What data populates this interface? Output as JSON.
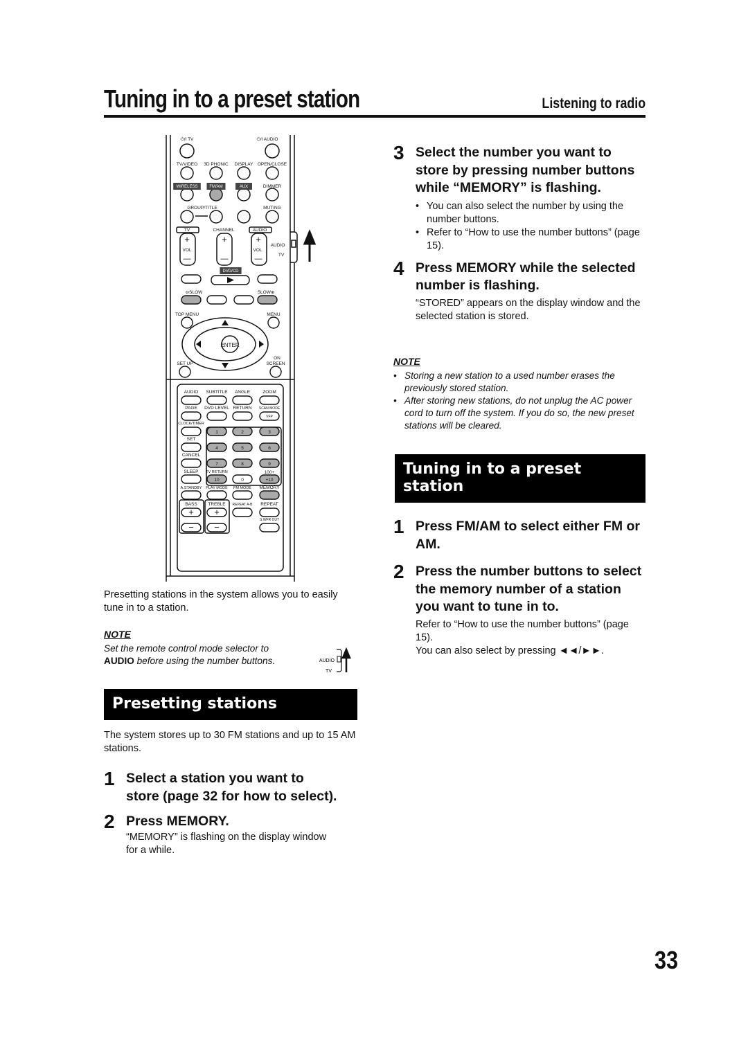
{
  "header": {
    "title": "Tuning in to a preset station",
    "section": "Listening to radio"
  },
  "left": {
    "intro": "Presetting stations in the system allows you to easily tune in to a station.",
    "note": {
      "heading": "NOTE",
      "line1": "Set the remote control mode selector to",
      "bold": "AUDIO",
      "line2": " before using the number buttons.",
      "switch_audio": "AUDIO",
      "switch_tv": "TV"
    },
    "banner": "Presetting stations",
    "desc": "The system stores up to 30 FM stations and up to 15 AM stations.",
    "steps": [
      {
        "num": "1",
        "head": "Select a station you want to store (page 32 for how to select)."
      },
      {
        "num": "2",
        "head": "Press MEMORY.",
        "text": "“MEMORY” is flashing on the display window for a while."
      }
    ]
  },
  "right": {
    "steps": [
      {
        "num": "3",
        "head": "Select the number you want to store by pressing number buttons while “MEMORY” is flashing.",
        "bullets": [
          "You can also select the number by using the number buttons.",
          "Refer to “How to use the number buttons” (page 15)."
        ]
      },
      {
        "num": "4",
        "head": "Press MEMORY while the selected number is flashing.",
        "text": "“STORED” appears on the display window and the selected station is stored."
      }
    ],
    "note": {
      "heading": "NOTE",
      "items": [
        "Storing a new station to a used number erases the previously stored station.",
        "After storing new stations, do not unplug the AC power cord to turn off the system. If you do so, the new preset stations will be cleared."
      ]
    },
    "banner": "Tuning in to a preset station",
    "steps2": [
      {
        "num": "1",
        "head": "Press FM/AM to select either FM or AM."
      },
      {
        "num": "2",
        "head": "Press the number buttons to select the memory number of a station you want to tune in to.",
        "text1": "Refer to “How to use the number buttons” (page 15).",
        "text2": "You can also select by pressing ◄◄/►►."
      }
    ]
  },
  "remote": {
    "power_tv": "⏻/I TV",
    "power_audio": "⏻/I AUDIO",
    "tv_video": "TV/VIDEO",
    "phonic": "3D PHONIC",
    "display": "DISPLAY",
    "open_close": "OPEN/CLOSE",
    "wireless": "WIRELESS",
    "fm_am": "FM/AM",
    "aux": "AUX",
    "dimmer": "DIMMER",
    "group_title": "GROUP/TITLE",
    "muting": "MUTING",
    "tv_box": "TV",
    "channel": "CHANNEL",
    "audio_box": "AUDIO",
    "vol_left": "VOL",
    "vol_right": "VOL",
    "sw_audio": "AUDIO",
    "sw_tv": "TV",
    "dvd_cd": "DVD/CD",
    "slow_minus": "⊖SLOW",
    "slow_plus": "SLOW⊕",
    "top_menu": "TOP MENU",
    "menu": "MENU",
    "enter": "ENTER",
    "set_up": "SET UP",
    "on": "ON",
    "screen": "SCREEN",
    "audio": "AUDIO",
    "subtitle": "SUBTITLE",
    "angle": "ANGLE",
    "zoom": "ZOOM",
    "page": "PAGE",
    "dvd_level": "DVD LEVEL",
    "return": "RETURN",
    "scan_mode": "SCAN MODE",
    "vfp": "VFP",
    "clock_timer": "CLOCK/TIMER",
    "set": "SET",
    "cancel": "CANCEL",
    "sleep": "SLEEP",
    "n1": "1",
    "n2": "2",
    "n3": "3",
    "n4": "4",
    "n5": "5",
    "n6": "6",
    "n7": "7",
    "n8": "8",
    "n9": "9",
    "n10": "10",
    "n0": "0",
    "plus10": "+10",
    "tv_return": "TV RETURN",
    "hundred": "100+",
    "a_standby": "A.STANDBY",
    "play_mode": "PLAY MODE",
    "fm_mode": "FM MODE",
    "memory": "MEMORY",
    "bass": "BASS",
    "treble": "TREBLE",
    "repeat_ab": "REPEAT A-B",
    "repeat": "REPEAT",
    "s_wfr_out": "S.WFR OUT"
  },
  "page_number": "33",
  "colors": {
    "text": "#111111",
    "banner_bg": "#000000",
    "button_gray": "#aaaaaa"
  }
}
